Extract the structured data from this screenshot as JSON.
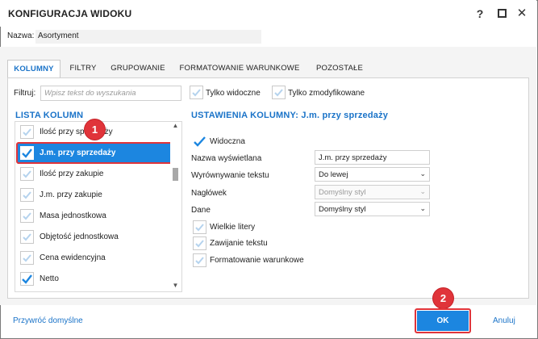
{
  "window": {
    "title": "KONFIGURACJA WIDOKU",
    "help": "?",
    "close": "✕"
  },
  "name": {
    "label": "Nazwa:",
    "value": "Asortyment"
  },
  "tabs": [
    {
      "label": "KOLUMNY",
      "active": true
    },
    {
      "label": "FILTRY",
      "active": false
    },
    {
      "label": "GRUPOWANIE",
      "active": false
    },
    {
      "label": "FORMATOWANIE WARUNKOWE",
      "active": false
    },
    {
      "label": "POZOSTAŁE",
      "active": false
    }
  ],
  "filter": {
    "label": "Filtruj:",
    "placeholder": "Wpisz tekst do wyszukania",
    "only_visible_label": "Tylko widoczne",
    "only_visible_checked": false,
    "only_modified_label": "Tylko zmodyfikowane",
    "only_modified_checked": false
  },
  "column_list": {
    "title": "LISTA KOLUMN",
    "items": [
      {
        "label": "Ilość przy sprzedaży",
        "checked": false
      },
      {
        "label": "J.m. przy sprzedaży",
        "checked": true,
        "selected": true
      },
      {
        "label": "Ilość przy zakupie",
        "checked": false
      },
      {
        "label": "J.m. przy zakupie",
        "checked": false
      },
      {
        "label": "Masa jednostkowa",
        "checked": false
      },
      {
        "label": "Objętość jednostkowa",
        "checked": false
      },
      {
        "label": "Cena ewidencyjna",
        "checked": false
      },
      {
        "label": "Netto",
        "checked": true
      }
    ]
  },
  "settings": {
    "title": "USTAWIENIA KOLUMNY: J.m. przy sprzedaży",
    "visible_label": "Widoczna",
    "visible_checked": true,
    "display_name_label": "Nazwa wyświetlana",
    "display_name_value": "J.m. przy sprzedaży",
    "alignment_label": "Wyrównywanie tekstu",
    "alignment_value": "Do lewej",
    "header_label": "Nagłówek",
    "header_value": "Domyślny styl",
    "data_label": "Dane",
    "data_value": "Domyślny styl",
    "uppercase_label": "Wielkie litery",
    "uppercase_checked": false,
    "wrap_label": "Zawijanie tekstu",
    "wrap_checked": false,
    "conditional_label": "Formatowanie warunkowe",
    "conditional_checked": false
  },
  "footer": {
    "restore_label": "Przywróć domyślne",
    "ok_label": "OK",
    "cancel_label": "Anuluj"
  },
  "badges": {
    "first": "1",
    "second": "2"
  },
  "colors": {
    "accent": "#1c86e0",
    "highlight": "#e0343a",
    "check_checked": "#1c86e0",
    "check_unchecked": "#b5d3ee"
  }
}
